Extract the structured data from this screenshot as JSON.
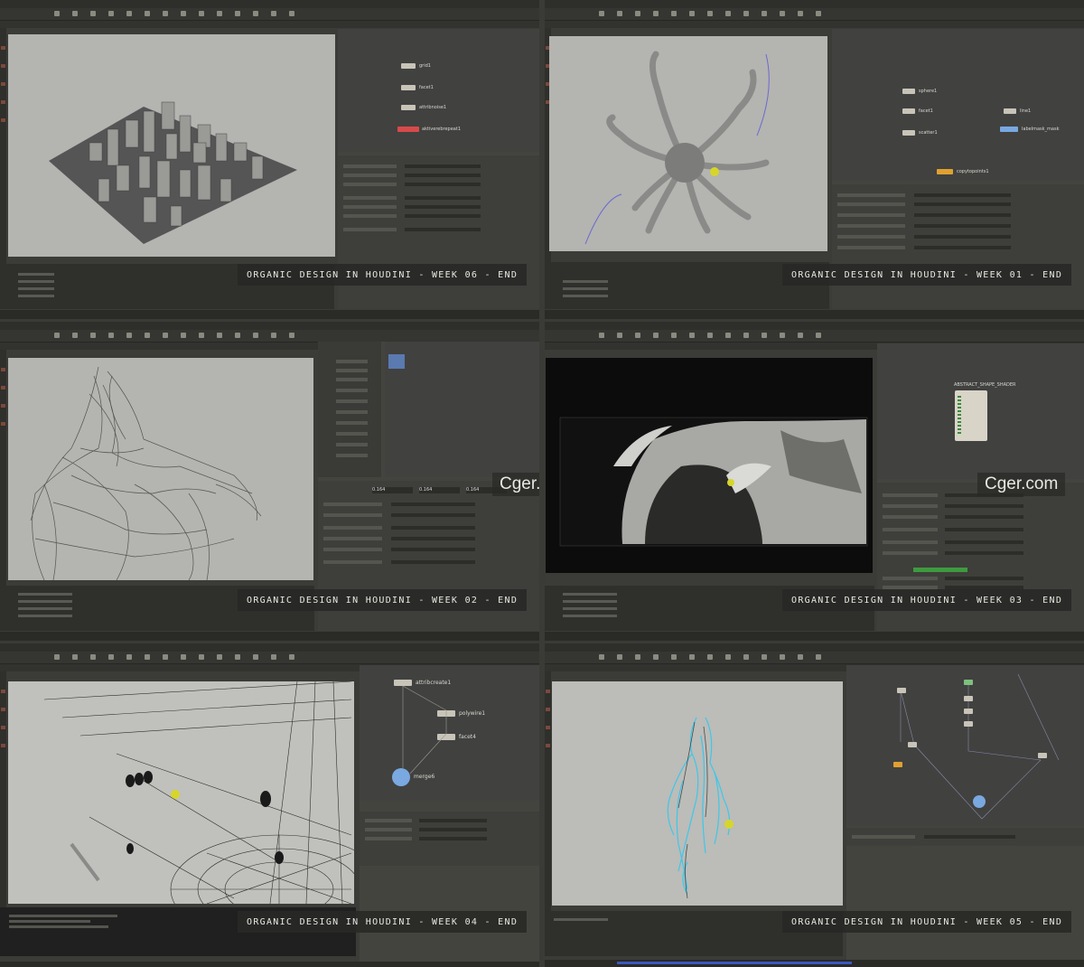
{
  "tiles": [
    {
      "caption": "ORGANIC DESIGN IN HOUDINI - WEEK 06 - END",
      "nodes": [
        "grid1",
        "facet1",
        "attribnoise1",
        "aktiverebrepeat1"
      ]
    },
    {
      "caption": "ORGANIC DESIGN IN HOUDINI - WEEK 01 - END",
      "nodes": [
        "sphere1",
        "facet1",
        "scatter1",
        "line1",
        "labelmask_mask",
        "copytopoints1"
      ]
    },
    {
      "caption": "ORGANIC DESIGN IN HOUDINI - WEEK 02 - END",
      "values": [
        "0.164",
        "0.164",
        "0.164"
      ]
    },
    {
      "caption": "ORGANIC DESIGN IN HOUDINI - WEEK 03 - END",
      "node": "ABSTRACT_SHAPE_SHADER"
    },
    {
      "caption": "ORGANIC DESIGN IN HOUDINI - WEEK 04 - END",
      "nodes": [
        "attribcreate1",
        "polywire1",
        "facet4",
        "merge6"
      ]
    },
    {
      "caption": "ORGANIC DESIGN IN HOUDINI - WEEK 05 - END"
    }
  ],
  "watermark": "Cger.com"
}
